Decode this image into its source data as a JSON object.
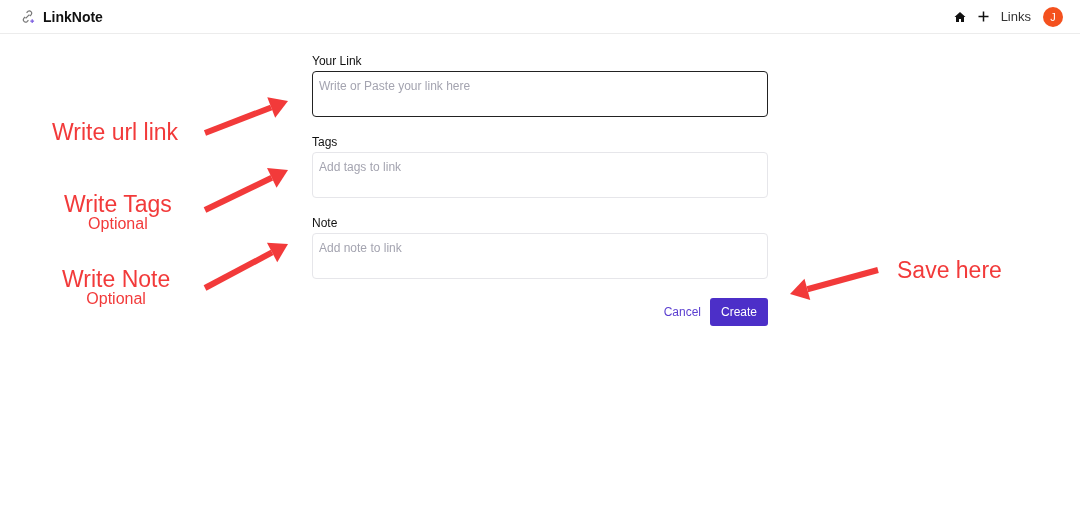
{
  "header": {
    "brand": "LinkNote",
    "nav_link": "Links",
    "avatar": "J"
  },
  "form": {
    "fields": [
      {
        "label": "Your Link",
        "placeholder": "Write or Paste your link here",
        "focused": true
      },
      {
        "label": "Tags",
        "placeholder": "Add tags to link",
        "focused": false
      },
      {
        "label": "Note",
        "placeholder": "Add note to link",
        "focused": false
      }
    ],
    "cancel": "Cancel",
    "submit": "Create"
  },
  "annotations": [
    {
      "text": "Write url link"
    },
    {
      "text": "Write Tags",
      "subtext": "Optional"
    },
    {
      "text": "Write Note",
      "subtext": "Optional"
    },
    {
      "text": "Save here"
    }
  ]
}
